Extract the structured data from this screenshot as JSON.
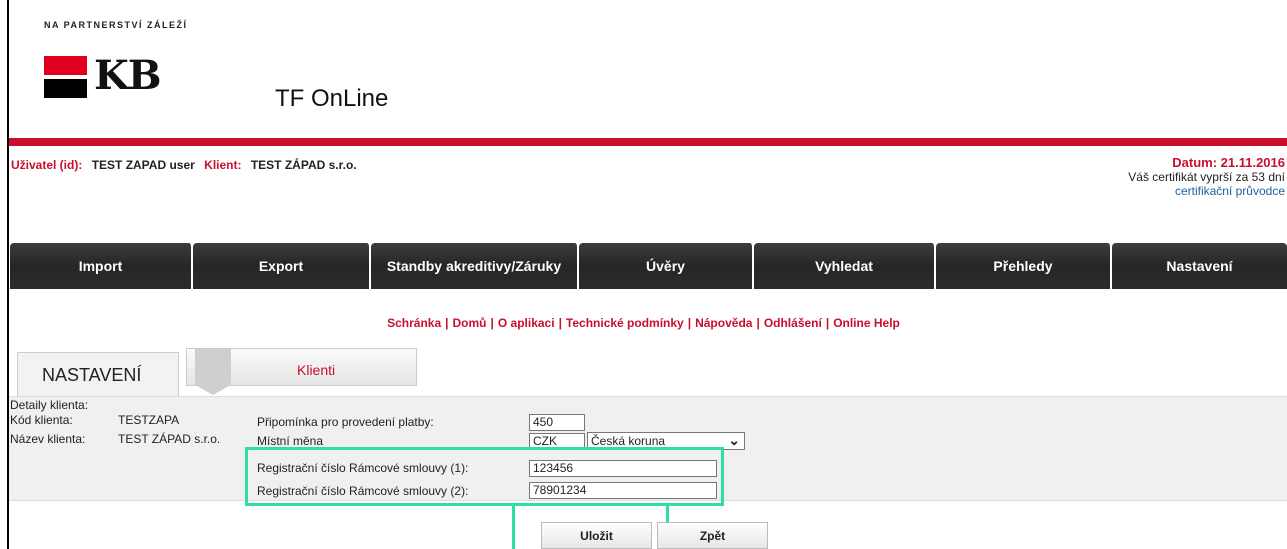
{
  "header": {
    "tagline": "NA PARTNERSTVÍ ZÁLEŽÍ",
    "logo_text": "KB",
    "app_name": "TF OnLine"
  },
  "user_bar": {
    "user_label": "Uživatel (id):",
    "user_value": "TEST ZAPAD user",
    "client_label": "Klient:",
    "client_value": "TEST ZÁPAD s.r.o.",
    "date": "Datum: 21.11.2016",
    "cert_expiry": "Váš certifikát vyprší za 53 dní",
    "cert_link": "certifikační průvodce"
  },
  "nav": {
    "items": [
      "Import",
      "Export",
      "Standby akreditivy/Záruky",
      "Úvěry",
      "Vyhledat",
      "Přehledy",
      "Nastavení"
    ]
  },
  "links": [
    "Schránka",
    "Domů",
    "O aplikaci",
    "Technické podmínky",
    "Nápověda",
    "Odhlášení",
    "Online Help"
  ],
  "tabs": {
    "active": "NASTAVENÍ",
    "sub": "Klienti"
  },
  "details": {
    "title": "Detaily klienta:",
    "code_label": "Kód klienta:",
    "code_value": "TESTZAPA",
    "name_label": "Název klienta:",
    "name_value": "TEST ZÁPAD s.r.o.",
    "reminder_label": "Připomínka pro provedení platby:",
    "reminder_value": "450",
    "currency_label": "Místní měna",
    "currency_code": "CZK",
    "currency_name": "Česká koruna",
    "reg1_label": "Registrační číslo Rámcové smlouvy (1):",
    "reg1_value": "123456",
    "reg2_label": "Registrační číslo Rámcové smlouvy (2):",
    "reg2_value": "78901234"
  },
  "buttons": {
    "save": "Uložit",
    "back": "Zpět"
  },
  "colors": {
    "brand_red": "#c8102e",
    "highlight": "#2de0a0"
  }
}
